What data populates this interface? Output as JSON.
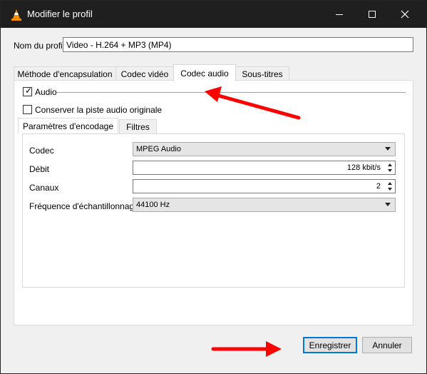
{
  "window": {
    "title": "Modifier le profil",
    "accent_color": "#ff0000"
  },
  "profile": {
    "label": "Nom du profil",
    "value": "Video - H.264 + MP3 (MP4)"
  },
  "tabs": [
    {
      "label": "Méthode d'encapsulation"
    },
    {
      "label": "Codec vidéo"
    },
    {
      "label": "Codec audio"
    },
    {
      "label": "Sous-titres"
    }
  ],
  "audio_tab": {
    "audio_checkbox_label": "Audio",
    "audio_checked": true,
    "keep_original_label": "Conserver la piste audio originale",
    "keep_original_checked": false,
    "inner_tabs": [
      {
        "label": "Paramètres d'encodage"
      },
      {
        "label": "Filtres"
      }
    ],
    "fields": {
      "codec_label": "Codec",
      "codec_value": "MPEG Audio",
      "bitrate_label": "Débit",
      "bitrate_value": "128 kbit/s",
      "channels_label": "Canaux",
      "channels_value": "2",
      "samplerate_label": "Fréquence d'échantillonnage",
      "samplerate_value": "44100 Hz"
    }
  },
  "buttons": {
    "save": "Enregistrer",
    "cancel": "Annuler"
  },
  "icons": {
    "app": "vlc-cone-icon",
    "minimize": "minimize-icon",
    "maximize": "maximize-icon",
    "close": "close-icon",
    "annotation": "red-arrow"
  }
}
